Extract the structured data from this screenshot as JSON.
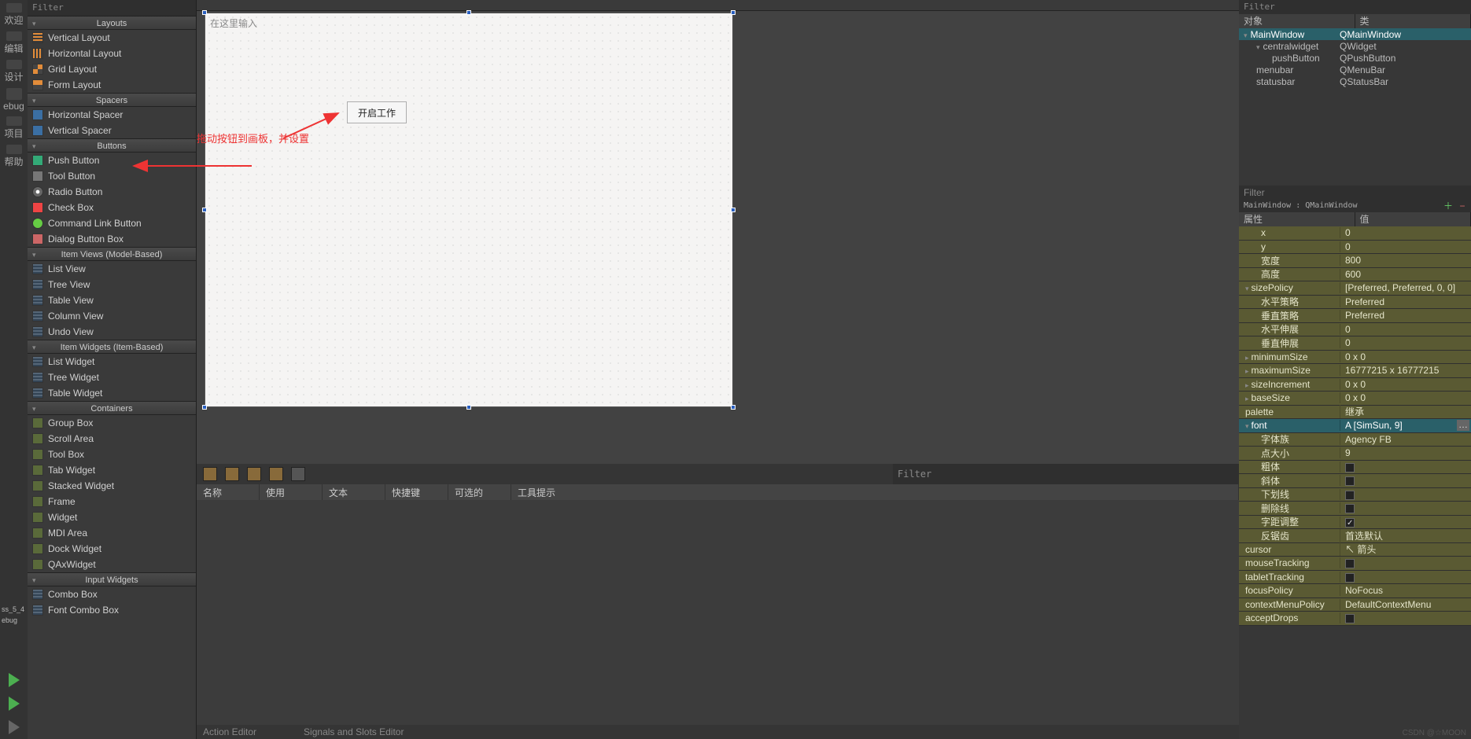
{
  "sidebar_left": {
    "items": [
      {
        "label": "欢迎"
      },
      {
        "label": "编辑"
      },
      {
        "label": "设计"
      },
      {
        "label": "ebug"
      },
      {
        "label": "项目"
      },
      {
        "label": "帮助"
      }
    ],
    "bottom_tag": "ss_5_4",
    "bottom_tag2": "ebug"
  },
  "widgetbox": {
    "filter_placeholder": "Filter",
    "categories": [
      {
        "title": "Layouts",
        "items": [
          "Vertical Layout",
          "Horizontal Layout",
          "Grid Layout",
          "Form Layout"
        ]
      },
      {
        "title": "Spacers",
        "items": [
          "Horizontal Spacer",
          "Vertical Spacer"
        ]
      },
      {
        "title": "Buttons",
        "items": [
          "Push Button",
          "Tool Button",
          "Radio Button",
          "Check Box",
          "Command Link Button",
          "Dialog Button Box"
        ]
      },
      {
        "title": "Item Views (Model-Based)",
        "items": [
          "List View",
          "Tree View",
          "Table View",
          "Column View",
          "Undo View"
        ]
      },
      {
        "title": "Item Widgets (Item-Based)",
        "items": [
          "List Widget",
          "Tree Widget",
          "Table Widget"
        ]
      },
      {
        "title": "Containers",
        "items": [
          "Group Box",
          "Scroll Area",
          "Tool Box",
          "Tab Widget",
          "Stacked Widget",
          "Frame",
          "Widget",
          "MDI Area",
          "Dock Widget",
          "QAxWidget"
        ]
      },
      {
        "title": "Input Widgets",
        "items": [
          "Combo Box",
          "Font Combo Box"
        ]
      }
    ]
  },
  "canvas": {
    "input_placeholder": "在这里输入",
    "push_button_text": "开启工作",
    "annotation": "拖动按钮到画板，并设置"
  },
  "action_editor": {
    "filter_placeholder": "Filter",
    "columns": [
      "名称",
      "使用",
      "文本",
      "快捷键",
      "可选的",
      "工具提示"
    ],
    "footer_left": "Action Editor",
    "footer_right": "Signals and Slots Editor"
  },
  "object_inspector": {
    "filter_placeholder": "Filter",
    "col1": "对象",
    "col2": "类",
    "rows": [
      {
        "name": "MainWindow",
        "cls": "QMainWindow",
        "indent": 0,
        "sel": true,
        "tw": "▾"
      },
      {
        "name": "centralwidget",
        "cls": "QWidget",
        "indent": 1,
        "tw": "▾"
      },
      {
        "name": "pushButton",
        "cls": "QPushButton",
        "indent": 2
      },
      {
        "name": "menubar",
        "cls": "QMenuBar",
        "indent": 1
      },
      {
        "name": "statusbar",
        "cls": "QStatusBar",
        "indent": 1
      }
    ]
  },
  "property_editor": {
    "filter_placeholder": "Filter",
    "context": "MainWindow : QMainWindow",
    "col1": "属性",
    "col2": "值",
    "rows": [
      {
        "name": "x",
        "value": "0",
        "style": "olive",
        "indent": 1
      },
      {
        "name": "y",
        "value": "0",
        "style": "olive",
        "indent": 1
      },
      {
        "name": "宽度",
        "value": "800",
        "style": "olive",
        "indent": 1
      },
      {
        "name": "高度",
        "value": "600",
        "style": "olive",
        "indent": 1
      },
      {
        "name": "sizePolicy",
        "value": "[Preferred, Preferred, 0, 0]",
        "style": "olive",
        "tw": "▾"
      },
      {
        "name": "水平策略",
        "value": "Preferred",
        "style": "olive",
        "indent": 1
      },
      {
        "name": "垂直策略",
        "value": "Preferred",
        "style": "olive",
        "indent": 1
      },
      {
        "name": "水平伸展",
        "value": "0",
        "style": "olive",
        "indent": 1
      },
      {
        "name": "垂直伸展",
        "value": "0",
        "style": "olive",
        "indent": 1
      },
      {
        "name": "minimumSize",
        "value": "0 x 0",
        "style": "olive",
        "tw": "▸"
      },
      {
        "name": "maximumSize",
        "value": "16777215 x 16777215",
        "style": "olive",
        "tw": "▸"
      },
      {
        "name": "sizeIncrement",
        "value": "0 x 0",
        "style": "olive",
        "tw": "▸"
      },
      {
        "name": "baseSize",
        "value": "0 x 0",
        "style": "olive",
        "tw": "▸"
      },
      {
        "name": "palette",
        "value": "继承",
        "style": "olive"
      },
      {
        "name": "font",
        "value": "A  [SimSun, 9]",
        "style": "teal",
        "tw": "▾",
        "ellipsis": true
      },
      {
        "name": "字体族",
        "value": "Agency FB",
        "style": "olive",
        "indent": 1
      },
      {
        "name": "点大小",
        "value": "9",
        "style": "olive",
        "indent": 1
      },
      {
        "name": "粗体",
        "value": "",
        "style": "olive",
        "indent": 1,
        "check": false
      },
      {
        "name": "斜体",
        "value": "",
        "style": "olive",
        "indent": 1,
        "check": false
      },
      {
        "name": "下划线",
        "value": "",
        "style": "olive",
        "indent": 1,
        "check": false
      },
      {
        "name": "删除线",
        "value": "",
        "style": "olive",
        "indent": 1,
        "check": false
      },
      {
        "name": "字距调整",
        "value": "",
        "style": "olive",
        "indent": 1,
        "check": true
      },
      {
        "name": "反锯齿",
        "value": "首选默认",
        "style": "olive",
        "indent": 1
      },
      {
        "name": "cursor",
        "value": "箭头",
        "style": "olive",
        "cursor": true
      },
      {
        "name": "mouseTracking",
        "value": "",
        "style": "olive",
        "check": false
      },
      {
        "name": "tabletTracking",
        "value": "",
        "style": "olive",
        "check": false
      },
      {
        "name": "focusPolicy",
        "value": "NoFocus",
        "style": "olive"
      },
      {
        "name": "contextMenuPolicy",
        "value": "DefaultContextMenu",
        "style": "olive"
      },
      {
        "name": "acceptDrops",
        "value": "",
        "style": "olive",
        "check": false
      }
    ]
  },
  "watermark": "CSDN @☆MOON"
}
